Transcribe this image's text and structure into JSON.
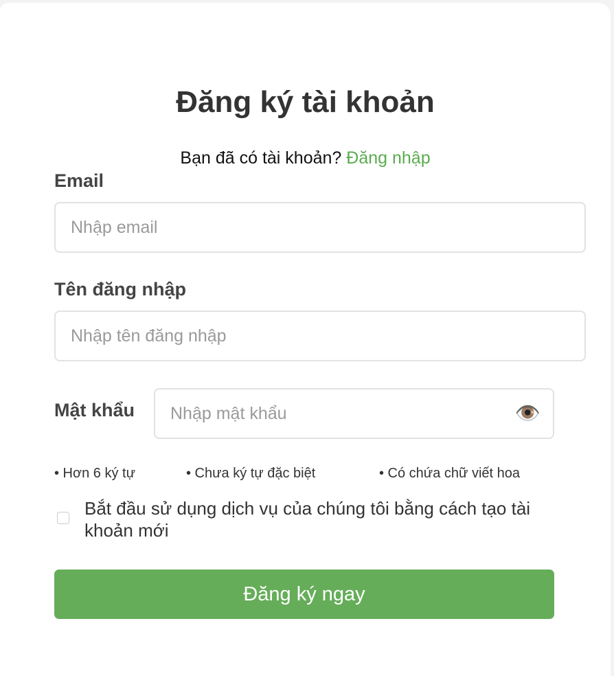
{
  "title": "Đăng ký tài khoản",
  "subtitle": {
    "text": "Bạn đã có tài khoản?",
    "login_link": "Đăng nhập"
  },
  "email": {
    "label": "Email",
    "placeholder": "Nhập email"
  },
  "username": {
    "label": "Tên đăng nhập",
    "placeholder": "Nhập tên đăng nhập"
  },
  "password": {
    "label": "Mật khẩu",
    "placeholder": "Nhập mật khẩu",
    "toggle_icon": "👁️"
  },
  "hints": [
    "• Hơn 6 ký tự",
    "• Chưa ký tự đặc biệt",
    "• Có chứa chữ viết hoa"
  ],
  "terms": {
    "text": "Bắt đầu sử dụng dịch vụ của chúng tôi bằng cách tạo tài khoản mới",
    "checked": false
  },
  "submit_label": "Đăng ký ngay",
  "colors": {
    "accent": "#66ad5a",
    "link": "#5aab4f"
  }
}
